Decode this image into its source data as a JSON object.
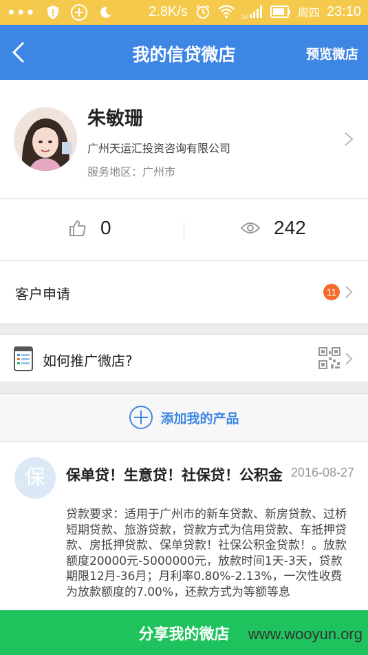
{
  "status_bar": {
    "dots": "•••",
    "net_speed": "2.8K/s",
    "network_label": "1x",
    "day": "周四",
    "time": "23:10",
    "background": "#f5c94b"
  },
  "nav": {
    "title": "我的信贷微店",
    "preview_label": "预览微店",
    "background": "#3e86e4"
  },
  "profile": {
    "name": "朱敏珊",
    "company": "广州天运汇投资咨询有限公司",
    "region": "服务地区：广州市"
  },
  "stats": {
    "likes": "0",
    "views": "242"
  },
  "customer_apply": {
    "label": "客户申请",
    "badge_count": "11"
  },
  "promo": {
    "label": "如何推广微店?"
  },
  "add_product": {
    "label": "添加我的产品"
  },
  "product": {
    "avatar_char": "保",
    "title": "保单贷！生意贷！社保贷！公积金",
    "date": "2016-08-27",
    "description": "贷款要求：适用于广州市的新车贷款、新房贷款、过桥短期贷款、旅游贷款，贷款方式为信用贷款、车抵押贷款、房抵押贷款、保单贷款！社保公积金贷款！。放款额度20000元-5000000元，放款时间1天-3天，贷款期限12月-36月；月利率0.80%-2.13%，一次性收费为放款额度的7.00%，还款方式为等额等息"
  },
  "share": {
    "label": "分享我的微店",
    "background": "#1fc35d"
  },
  "watermark": "www.wooyun.org",
  "colors": {
    "badge": "#f46c2a",
    "accent": "#3e86e4"
  }
}
